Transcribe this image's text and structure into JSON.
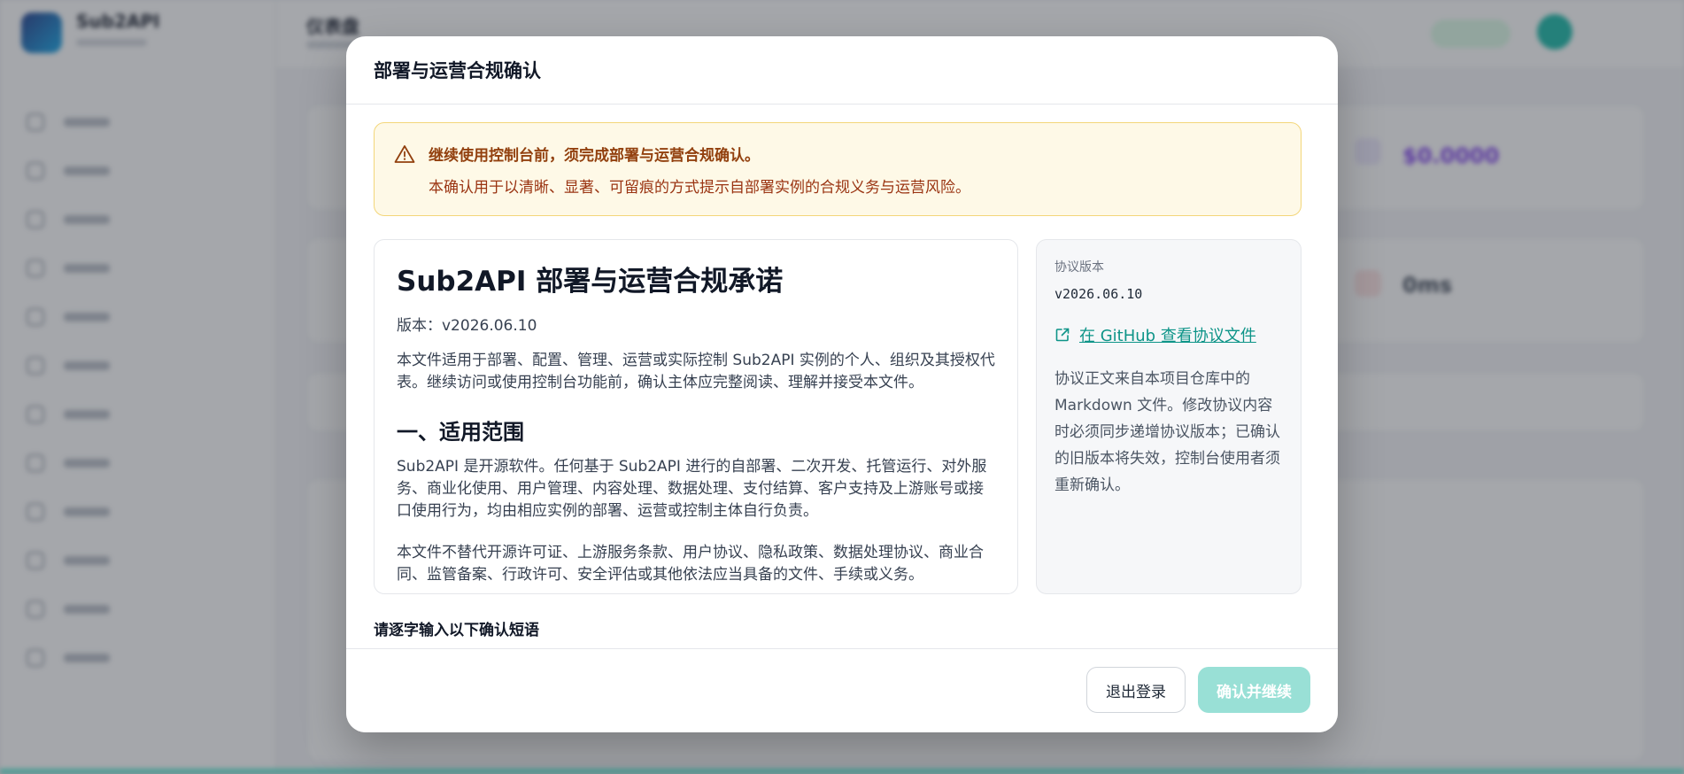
{
  "modal": {
    "title": "部署与运营合规确认",
    "warning": {
      "title": "继续使用控制台前，须完成部署与运营合规确认。",
      "body": "本确认用于以清晰、显著、可留痕的方式提示自部署实例的合规义务与运营风险。"
    },
    "document": {
      "heading": "Sub2API 部署与运营合规承诺",
      "version": "版本：v2026.06.10",
      "intro": "本文件适用于部署、配置、管理、运营或实际控制 Sub2API 实例的个人、组织及其授权代表。继续访问或使用控制台功能前，确认主体应完整阅读、理解并接受本文件。",
      "section1_title": "一、适用范围",
      "section1_p1": "Sub2API 是开源软件。任何基于 Sub2API 进行的自部署、二次开发、托管运行、对外服务、商业化使用、用户管理、内容处理、数据处理、支付结算、客户支持及上游账号或接口使用行为，均由相应实例的部署、运营或控制主体自行负责。",
      "section1_p2": "本文件不替代开源许可证、上游服务条款、用户协议、隐私政策、数据处理协议、商业合同、监管备案、行政许可、安全评估或其他依法应当具备的文件、手续或义务。"
    },
    "side": {
      "version_label": "协议版本",
      "version_value": "v2026.06.10",
      "github_link": "在 GitHub 查看协议文件",
      "note": "协议正文来自本项目仓库中的 Markdown 文件。修改协议内容时必须同步递增协议版本；已确认的旧版本将失效，控制台使用者须重新确认。"
    },
    "phrase_label": "请逐字输入以下确认短语",
    "footer": {
      "logout": "退出登录",
      "confirm": "确认并继续"
    }
  },
  "background": {
    "brand": "Sub2API",
    "page_title": "仪表盘",
    "stat_value_1": "$0.0000",
    "stat_value_2": "0ms"
  },
  "colors": {
    "accent": "#0d9488",
    "confirm_button": "#99e0d6",
    "warning_bg": "#fef9e7",
    "warning_border": "#f3d67a",
    "warning_text": "#92400e"
  }
}
